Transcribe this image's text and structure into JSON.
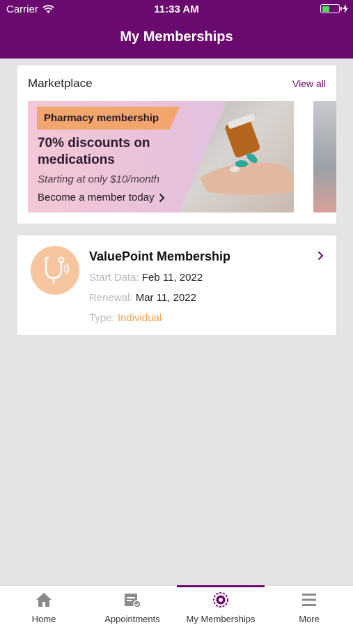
{
  "status_bar": {
    "carrier": "Carrier",
    "time": "11:33 AM"
  },
  "header": {
    "title": "My Memberships"
  },
  "marketplace": {
    "title": "Marketplace",
    "view_all": "View all",
    "banner": {
      "tag": "Pharmacy membership",
      "headline_line1": "70% discounts on",
      "headline_line2": "medications",
      "subtitle": "Starting at only $10/month",
      "cta": "Become a member today"
    }
  },
  "membership": {
    "name": "ValuePoint Membership",
    "start_label": "Start Data:",
    "start_value": "Feb 11, 2022",
    "renewal_label": "Renewal:",
    "renewal_value": "Mar 11, 2022",
    "type_label": "Type:",
    "type_value": "Individual",
    "icon": "stethoscope-icon"
  },
  "tabs": [
    {
      "label": "Home",
      "icon": "home-icon"
    },
    {
      "label": "Appointments",
      "icon": "calendar-check-icon"
    },
    {
      "label": "My Memberships",
      "icon": "membership-badge-icon"
    },
    {
      "label": "More",
      "icon": "menu-icon"
    }
  ],
  "colors": {
    "brand": "#6b0a6e",
    "accent_orange": "#f0a24e",
    "tag_orange": "#f2a66e",
    "avatar_bg": "#f7c6a0"
  }
}
